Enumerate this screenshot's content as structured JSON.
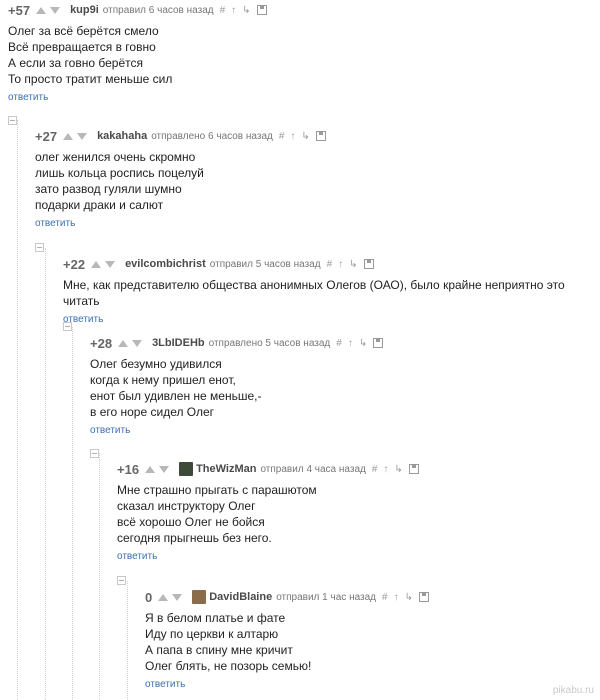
{
  "reply_label": "ответить",
  "watermark": "pikabu.ru",
  "comments": [
    {
      "rating": "+57",
      "author": "kup9i",
      "meta": "отправил 6 часов назад",
      "has_avatar": false,
      "lines": [
        "Олег за всё берётся смело",
        "Всё превращается в говно",
        "А если за говно берётся",
        "То просто тратит меньше сил"
      ]
    },
    {
      "rating": "+27",
      "author": "kakahaha",
      "meta": "отправлено 6 часов назад",
      "has_avatar": false,
      "lines": [
        "олег женился очень скромно",
        "лишь кольца роспись поцелуй",
        "зато развод гуляли шумно",
        "подарки драки и салют"
      ]
    },
    {
      "rating": "+22",
      "author": "evilcombichrist",
      "meta": "отправил 5 часов назад",
      "has_avatar": false,
      "lines": [
        "Мне, как представителю общества анонимных Олегов (ОАО), было крайне неприятно это читать"
      ]
    },
    {
      "rating": "+28",
      "author": "3LbIDEHb",
      "meta": "отправлено 5 часов назад",
      "has_avatar": false,
      "lines": [
        "Олег безумно удивился",
        "когда к нему пришел енот,",
        "енот был удивлен не меньше,-",
        "в его норе сидел Олег"
      ]
    },
    {
      "rating": "+16",
      "author": "TheWizMan",
      "meta": "отправил 4 часа назад",
      "has_avatar": true,
      "lines": [
        "Мне страшно прыгать с парашютом",
        "сказал инструктору Олег",
        "всё хорошо Олег не бойся",
        "сегодня прыгнешь без него."
      ]
    },
    {
      "rating": "0",
      "author": "DavidBlaine",
      "meta": "отправил 1 час назад",
      "has_avatar": true,
      "lines": [
        "Я в белом платье и фате",
        "Иду по церкви к алтарю",
        "А папа в спину мне кричит",
        "Олег блять, не позорь семью!"
      ]
    }
  ],
  "colors": {
    "link": "#3b6fb1",
    "rating": "#666666",
    "arrow": "#b8b8b8",
    "watermark": "#c9c9c9"
  },
  "icons": [
    "thumb-up-icon",
    "thumb-down-icon",
    "hash-icon",
    "arrow-up-icon",
    "reply-arrow-icon",
    "save-icon"
  ]
}
